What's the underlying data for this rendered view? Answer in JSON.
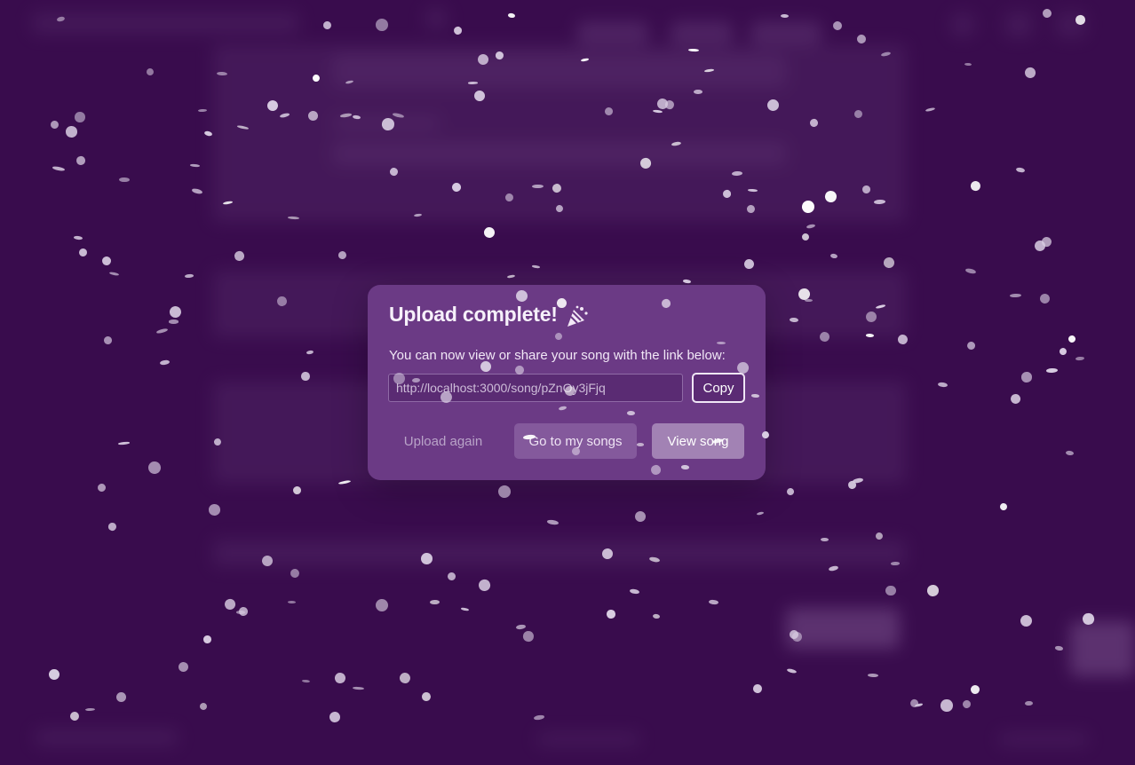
{
  "colors": {
    "page_background": "#43105a",
    "modal_background": "#6b3a85",
    "confetti": "#d9cde2"
  },
  "modal": {
    "title": "Upload complete!",
    "title_icon": "party-popper-icon",
    "description": "You can now view or share your song with the link below:",
    "link_value": "http://localhost:3000/song/pZnOy3jFjq",
    "copy_label": "Copy",
    "actions": {
      "upload_again": "Upload again",
      "my_songs": "Go to my songs",
      "view_song": "View song"
    }
  }
}
